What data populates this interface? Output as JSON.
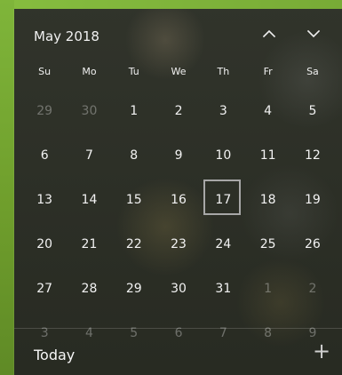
{
  "calendar": {
    "month_label": "May 2018",
    "weekday_labels": [
      "Su",
      "Mo",
      "Tu",
      "We",
      "Th",
      "Fr",
      "Sa"
    ],
    "weeks": [
      [
        "29",
        "30",
        "1",
        "2",
        "3",
        "4",
        "5"
      ],
      [
        "6",
        "7",
        "8",
        "9",
        "10",
        "11",
        "12"
      ],
      [
        "13",
        "14",
        "15",
        "16",
        "17",
        "18",
        "19"
      ],
      [
        "20",
        "21",
        "22",
        "23",
        "24",
        "25",
        "26"
      ],
      [
        "27",
        "28",
        "29",
        "30",
        "31",
        "1",
        "2"
      ],
      [
        "3",
        "4",
        "5",
        "6",
        "7",
        "8",
        "9"
      ]
    ],
    "selected_day": "17",
    "prev_icon": "chevron-up-icon",
    "next_icon": "chevron-down-icon"
  },
  "agenda": {
    "label": "Today",
    "add_icon": "plus-icon"
  }
}
